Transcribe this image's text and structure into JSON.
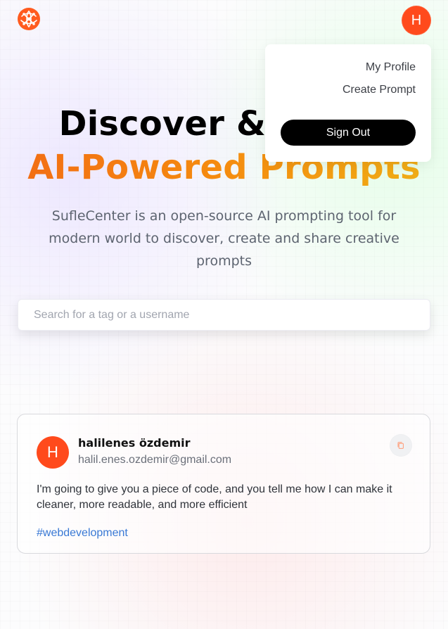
{
  "header": {
    "user_avatar_initial": "H"
  },
  "menu": {
    "items": [
      {
        "label": "My Profile"
      },
      {
        "label": "Create Prompt"
      }
    ],
    "sign_out_label": "Sign Out"
  },
  "hero": {
    "title_line_1": "Discover & Share",
    "title_line_2": "AI-Powered Prompts",
    "description": "SufleCenter is an open-source AI prompting tool for modern world to discover, create and share creative prompts"
  },
  "search": {
    "placeholder": "Search for a tag or a username"
  },
  "prompt_card": {
    "avatar_initial": "H",
    "author_name": "halilenes özdemir",
    "author_email": "halil.enes.ozdemir@gmail.com",
    "text": "I'm going to give you a piece of code, and you tell me how I can make it cleaner, more readable, and more efficient",
    "tag": "#webdevelopment"
  },
  "icons": {
    "logo": "globe-network-icon",
    "copy": "copy-icon"
  },
  "colors": {
    "accent": "#ff4a1c",
    "gradient_start": "#f26b14",
    "gradient_end": "#efb117",
    "tag": "#3979d5"
  }
}
